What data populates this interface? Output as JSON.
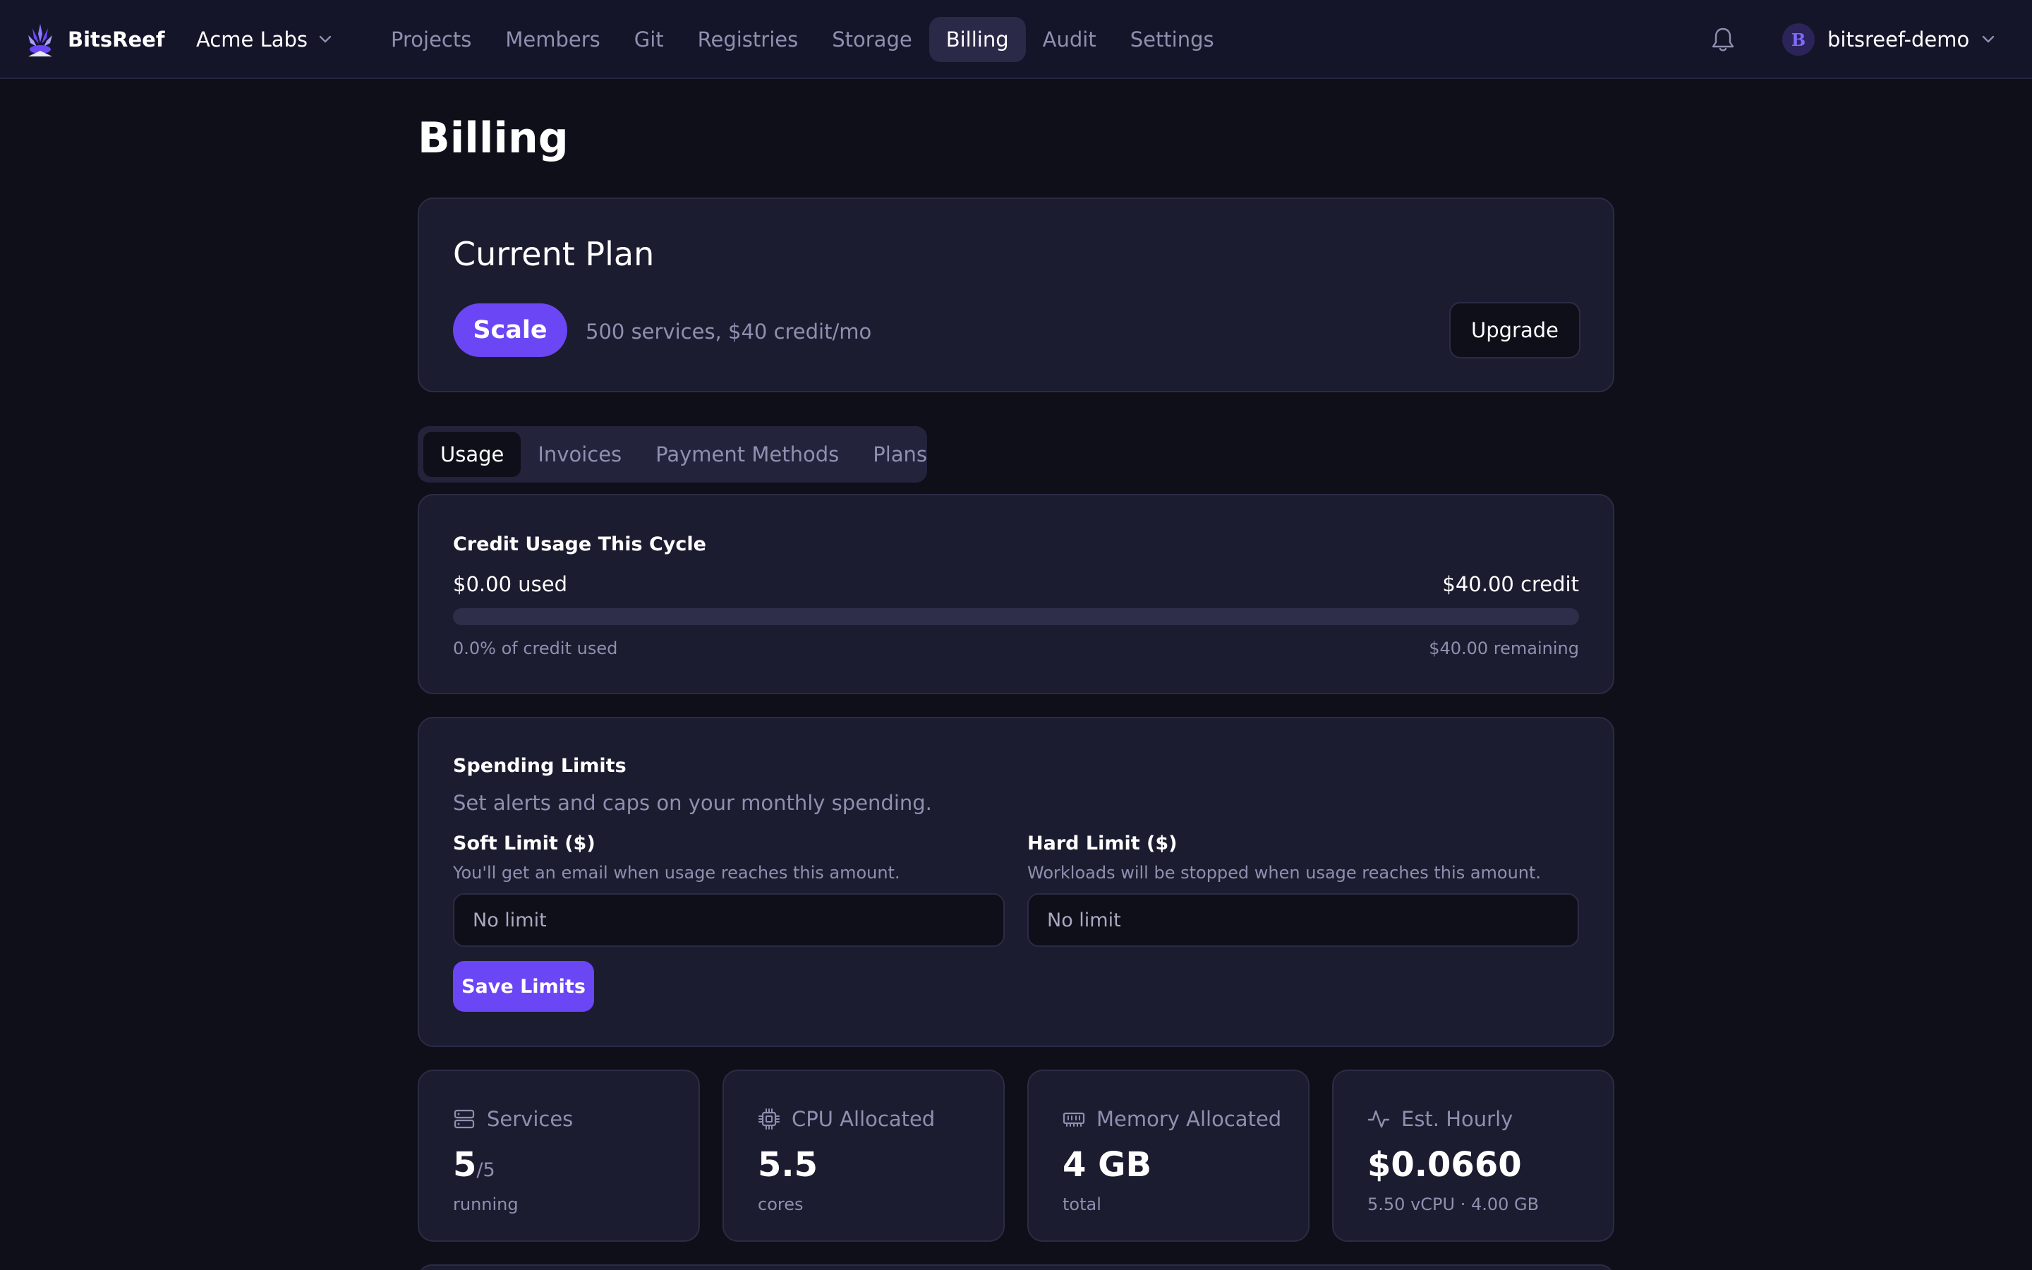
{
  "app": {
    "brand": "BitsReef",
    "org": "Acme Labs"
  },
  "nav": {
    "items": [
      "Projects",
      "Members",
      "Git",
      "Registries",
      "Storage",
      "Billing",
      "Audit",
      "Settings"
    ],
    "active": "Billing"
  },
  "user": {
    "initial": "B",
    "name": "bitsreef-demo"
  },
  "page": {
    "title": "Billing"
  },
  "plan": {
    "title": "Current Plan",
    "name": "Scale",
    "description": "500 services, $40 credit/mo",
    "upgrade_label": "Upgrade"
  },
  "tabs": {
    "items": [
      "Usage",
      "Invoices",
      "Payment Methods",
      "Plans"
    ],
    "active": "Usage"
  },
  "usage": {
    "title": "Credit Usage This Cycle",
    "used": "$0.00 used",
    "credit": "$40.00 credit",
    "percent_text": "0.0% of credit used",
    "remaining": "$40.00 remaining",
    "progress_fraction": 0.0
  },
  "limits": {
    "title": "Spending Limits",
    "description": "Set alerts and caps on your monthly spending.",
    "soft": {
      "label": "Soft Limit ($)",
      "help": "You'll get an email when usage reaches this amount.",
      "value": "",
      "placeholder": "No limit"
    },
    "hard": {
      "label": "Hard Limit ($)",
      "help": "Workloads will be stopped when usage reaches this amount.",
      "value": "",
      "placeholder": "No limit"
    },
    "save_label": "Save Limits"
  },
  "stats": {
    "services": {
      "icon": "server-icon",
      "label": "Services",
      "value": "5",
      "suffix": "/5",
      "note": "running"
    },
    "cpu": {
      "icon": "cpu-icon",
      "label": "CPU Allocated",
      "value": "5.5",
      "note": "cores"
    },
    "memory": {
      "icon": "memory-icon",
      "label": "Memory Allocated",
      "value": "4 GB",
      "note": "total"
    },
    "hourly": {
      "icon": "activity-icon",
      "label": "Est. Hourly",
      "value": "$0.0660",
      "note": "5.50 vCPU · 4.00 GB"
    }
  },
  "colors": {
    "accent": "#6b46f5",
    "background": "#0f0f1a",
    "card": "#1c1c30",
    "muted_text": "#8f8fb0"
  }
}
